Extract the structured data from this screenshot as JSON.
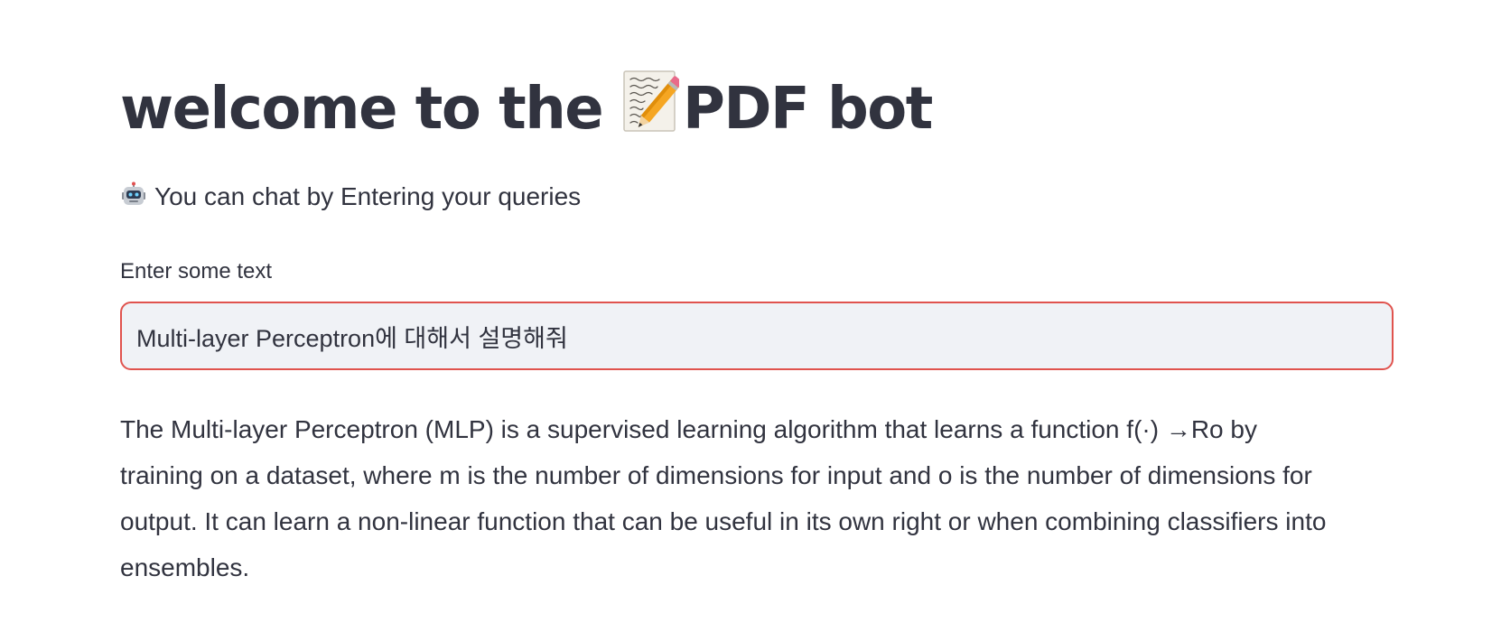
{
  "title": {
    "before": "welcome to the",
    "emoji": "memo-pencil-icon",
    "after": "PDF bot"
  },
  "subtitle": {
    "icon": "robot-icon",
    "text": "You can chat by Entering your queries"
  },
  "query_input": {
    "label": "Enter some text",
    "value": "Multi-layer Perceptron에 대해서 설명해줘",
    "focus_color": "#e0534e"
  },
  "answer": {
    "text": "The Multi-layer Perceptron (MLP) is a supervised learning algorithm that learns a function f(·) →Ro by training on a dataset, where m is the number of dimensions for input and o is the number of dimensions for output. It can learn a non-linear function that can be useful in its own right or when combining classifiers into ensembles."
  }
}
